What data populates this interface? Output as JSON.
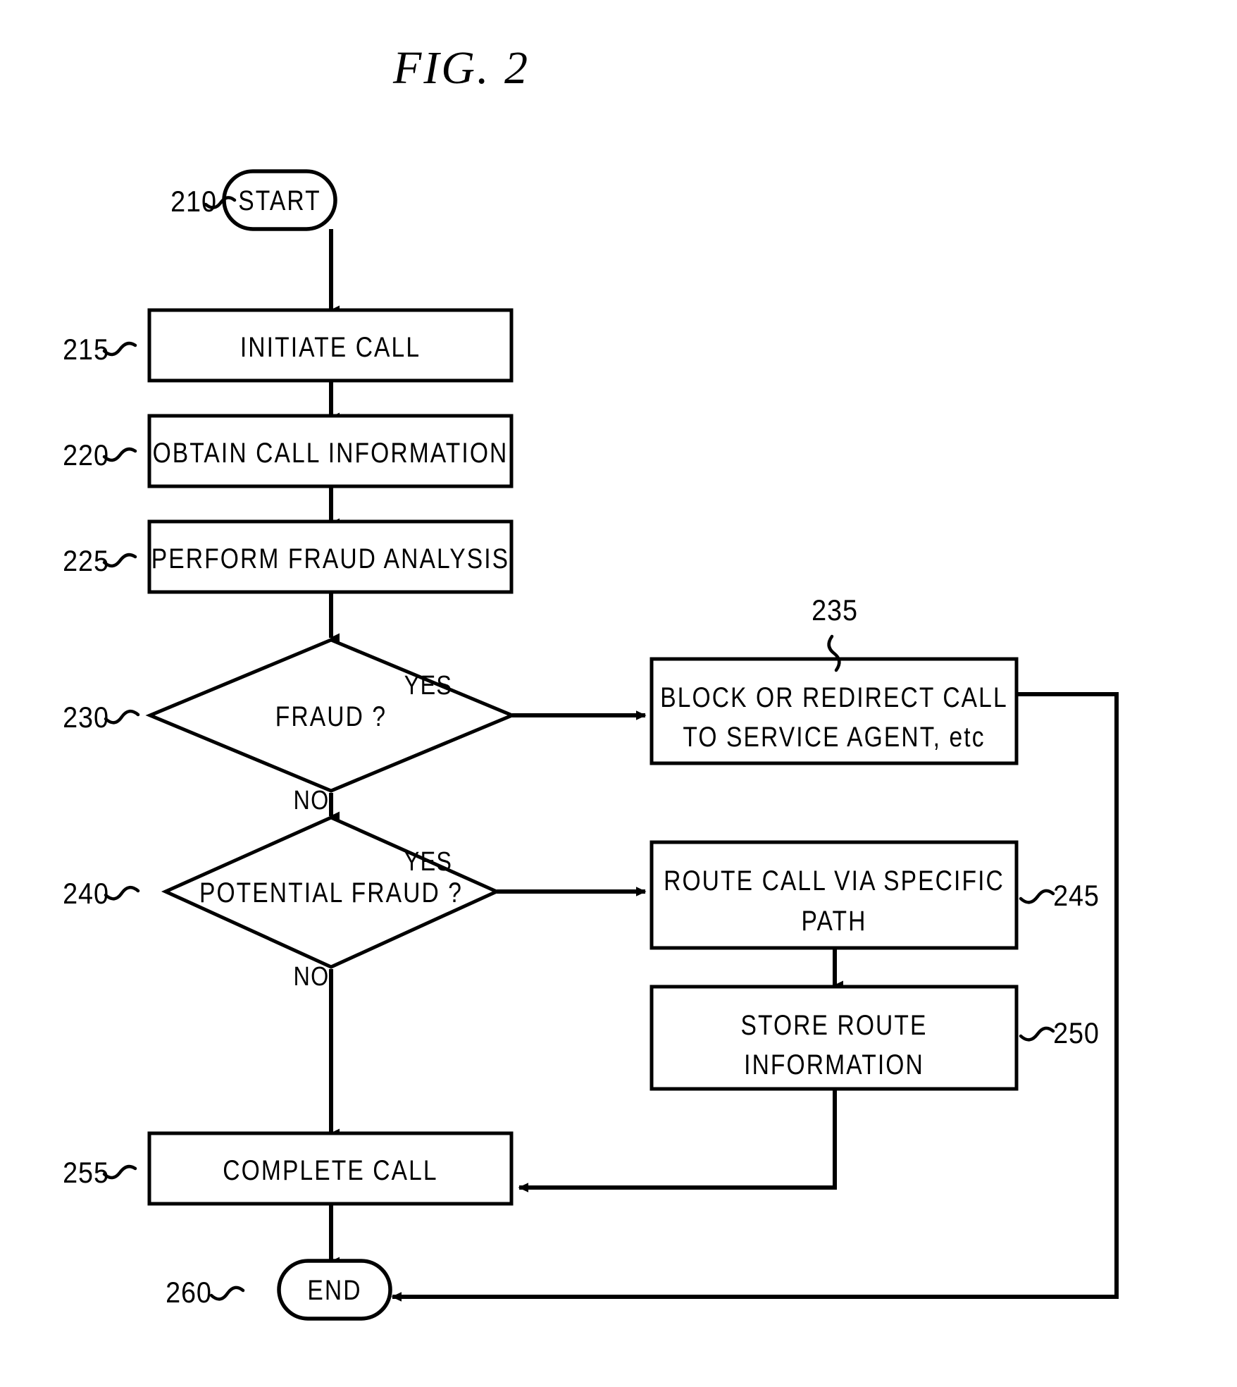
{
  "figure": {
    "title": "FIG.  2",
    "type": "patent-flowchart"
  },
  "nodes": {
    "start": {
      "ref": "210",
      "label": "START",
      "shape": "terminator"
    },
    "initiate_call": {
      "ref": "215",
      "label": "INITIATE CALL",
      "shape": "process"
    },
    "obtain_info": {
      "ref": "220",
      "label": "OBTAIN CALL INFORMATION",
      "shape": "process"
    },
    "fraud_analysis": {
      "ref": "225",
      "label": "PERFORM FRAUD ANALYSIS",
      "shape": "process"
    },
    "fraud_decision": {
      "ref": "230",
      "label": "FRAUD ?",
      "shape": "decision"
    },
    "block_redirect": {
      "ref": "235",
      "line1": "BLOCK OR REDIRECT CALL",
      "line2": "TO SERVICE AGENT, etc",
      "shape": "process"
    },
    "potential_fraud_decision": {
      "ref": "240",
      "label": "POTENTIAL FRAUD ?",
      "shape": "decision"
    },
    "route_call": {
      "ref": "245",
      "line1": "ROUTE CALL VIA SPECIFIC",
      "line2": "PATH",
      "shape": "process"
    },
    "store_route": {
      "ref": "250",
      "line1": "STORE ROUTE",
      "line2": "INFORMATION",
      "shape": "process"
    },
    "complete_call": {
      "ref": "255",
      "label": "COMPLETE CALL",
      "shape": "process"
    },
    "end": {
      "ref": "260",
      "label": "END",
      "shape": "terminator"
    }
  },
  "branch_labels": {
    "fraud_yes": "YES",
    "fraud_no": "NO",
    "potential_yes": "YES",
    "potential_no": "NO"
  },
  "colors": {
    "ink": "#000000",
    "paper": "#ffffff"
  }
}
